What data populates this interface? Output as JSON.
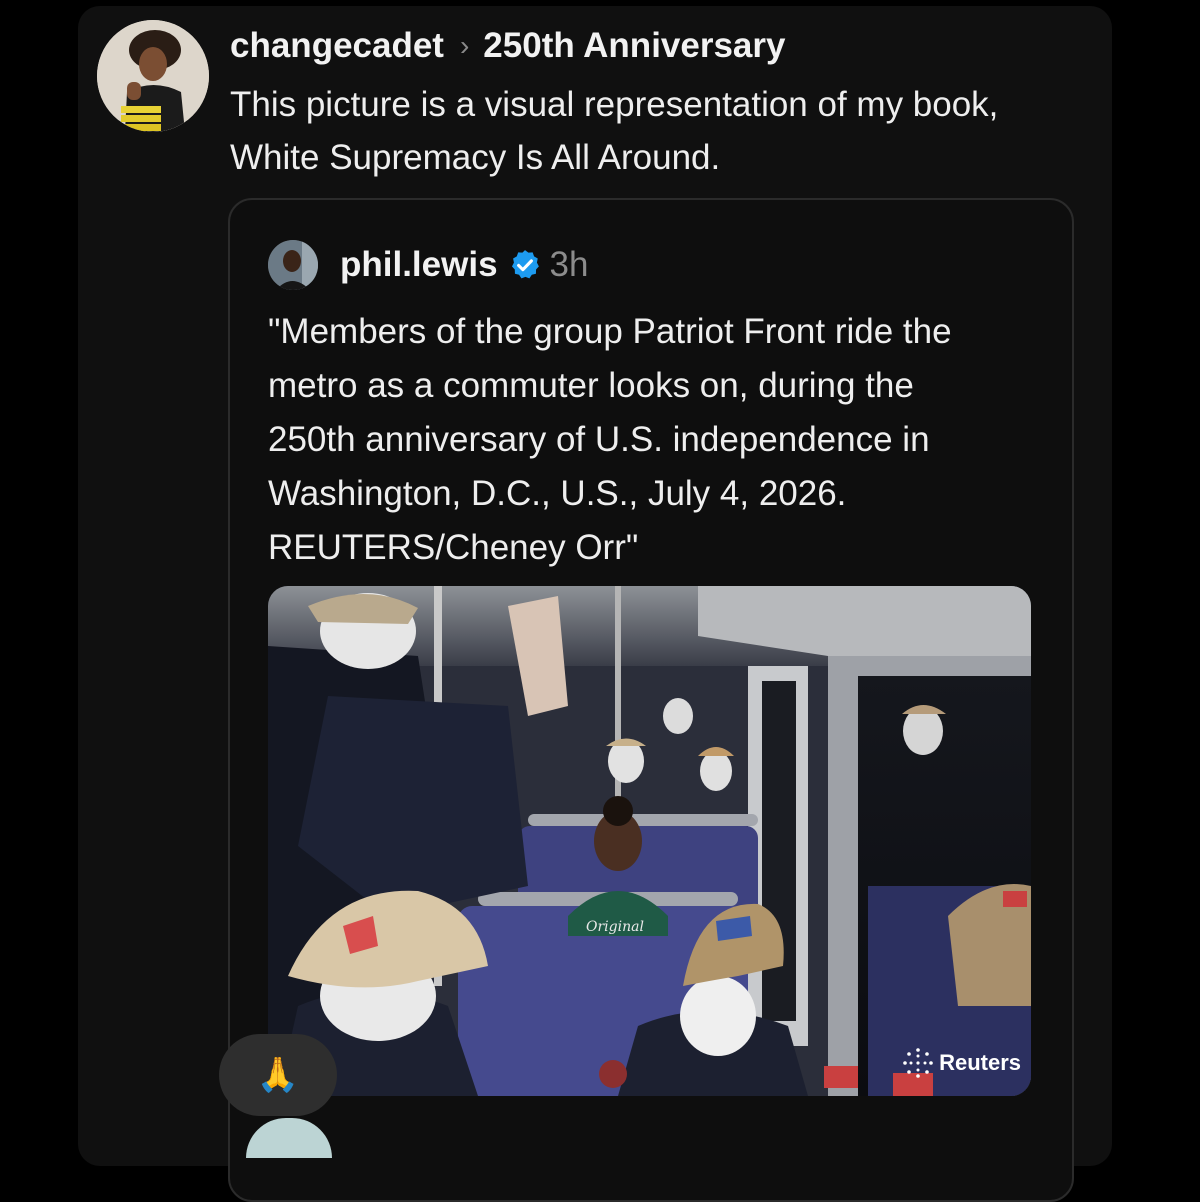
{
  "post": {
    "username": "changecadet",
    "separator": "›",
    "topic": "250th Anniversary",
    "text": "This picture is a visual representation of my book,\nWhite Supremacy Is All Around."
  },
  "quoted_post": {
    "username": "phil.lewis",
    "verified": true,
    "time": "3h",
    "text": "\"Members of the group Patriot Front ride the\nmetro as a commuter looks on, during the\n250th anniversary of U.S. independence in\nWashington, D.C., U.S., July 4, 2026.\nREUTERS/Cheney Orr\"",
    "image": {
      "watermark": "Reuters",
      "shirt_print": "Original"
    }
  },
  "reaction": {
    "emoji": "🙏"
  },
  "colors": {
    "background": "#000000",
    "card": "#101010",
    "verified_blue": "#1d9bf0",
    "muted": "#8c8c8c"
  },
  "icons": [
    "chevron-right-icon",
    "verified-badge-icon",
    "folded-hands-emoji"
  ]
}
